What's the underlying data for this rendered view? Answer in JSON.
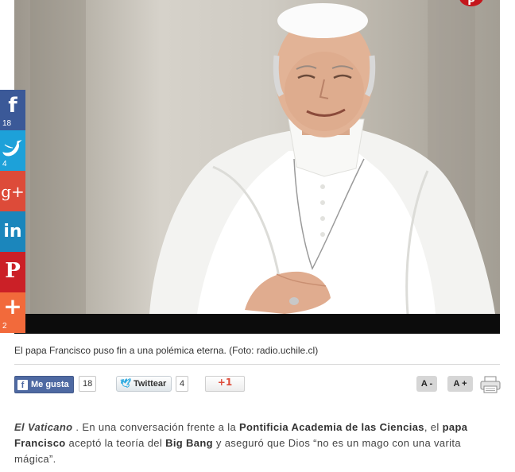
{
  "photo": {
    "caption": "El papa Francisco puso fin a una polémica eterna. (Foto: radio.uchile.cl)",
    "corner_logo": "P"
  },
  "social_sidebar": {
    "items": [
      {
        "network": "facebook",
        "glyph": "f",
        "count": "18",
        "icon": "facebook-icon",
        "color": "#3b5998"
      },
      {
        "network": "twitter",
        "glyph": "",
        "count": "4",
        "icon": "twitter-bird-icon",
        "color": "#1da1d9"
      },
      {
        "network": "google-plus",
        "glyph": "g+",
        "count": "",
        "icon": "google-plus-icon",
        "color": "#dd4b39"
      },
      {
        "network": "linkedin",
        "glyph": "in",
        "count": "",
        "icon": "linkedin-icon",
        "color": "#1b86bc"
      },
      {
        "network": "pinterest",
        "glyph": "P",
        "count": "",
        "icon": "pinterest-icon",
        "color": "#cb2027"
      },
      {
        "network": "more",
        "glyph": "+",
        "count": "2",
        "icon": "plus-icon",
        "color": "#f26a3b"
      }
    ]
  },
  "share_row": {
    "fb_like_label": "Me gusta",
    "fb_like_count": "18",
    "twitter_label": "Twittear",
    "twitter_count": "4",
    "gplus_label": "+1",
    "font_decrease": "A -",
    "font_increase": "A +"
  },
  "article": {
    "place": "El Vaticano",
    "t1": " . En una conversación frente a la ",
    "academy": "Pontificia Academia de las Ciencias",
    "t2": ", el ",
    "pope": "papa Francisco",
    "t3": " aceptó la teoría del ",
    "bigbang": "Big Bang",
    "t4": " y aseguró que Dios “no es un mago con una varita mágica”."
  }
}
